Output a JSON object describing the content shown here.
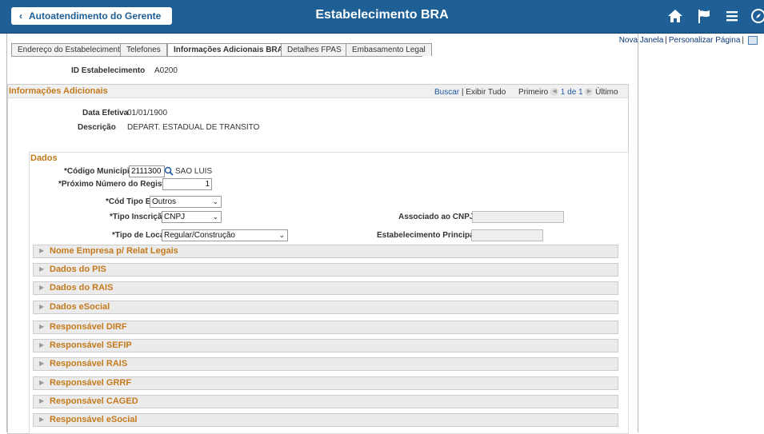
{
  "header": {
    "back_label": "Autoatendimento do Gerente",
    "title": "Estabelecimento BRA",
    "icons": [
      "home-icon",
      "flag-icon",
      "menu-icon",
      "compass-icon"
    ]
  },
  "toplinks": {
    "new_window": "Nova Janela",
    "personalize": "Personalizar Página"
  },
  "tabs": [
    {
      "label": "Endereço do Estabelecimento",
      "active": false
    },
    {
      "label": "Telefones",
      "active": false
    },
    {
      "label": "Informações Adicionais BRA",
      "active": true
    },
    {
      "label": "Detalhes FPAS",
      "active": false
    },
    {
      "label": "Embasamento Legal",
      "active": false
    }
  ],
  "establishment": {
    "id_label": "ID Estabelecimento",
    "id_value": "A0200"
  },
  "info_section": {
    "title": "Informações Adicionais",
    "search": "Buscar",
    "show_all": "Exibir Tudo",
    "first": "Primeiro",
    "paging": "1 de 1",
    "last": "Último",
    "effective_date_label": "Data Efetiva",
    "effective_date_value": "01/01/1900",
    "description_label": "Descrição",
    "description_value": "DEPART. ESTADUAL DE TRANSITO"
  },
  "dados": {
    "title": "Dados",
    "municipio_label": "*Código Município",
    "municipio_value": "2111300",
    "municipio_name": "SAO LUIS",
    "proximo_label": "*Próximo Número do Registro",
    "proximo_value": "1",
    "cod_tipo_label": "*Cód Tipo Estab",
    "cod_tipo_value": "Outros",
    "tipo_inscricao_label": "*Tipo Inscrição",
    "tipo_inscricao_value": "CNPJ",
    "associado_label": "Associado ao CNPJ",
    "tipo_local_label": "*Tipo de Local",
    "tipo_local_value": "Regular/Construção",
    "estab_principal_label": "Estabelecimento Principal"
  },
  "collapsibles": [
    "Nome Empresa p/ Relat Legais",
    "Dados do PIS",
    "Dados do RAIS",
    "Dados eSocial",
    "Responsável DIRF",
    "Responsável SEFIP",
    "Responsável RAIS",
    "Responsável GRRF",
    "Responsável CAGED",
    "Responsável eSocial"
  ]
}
